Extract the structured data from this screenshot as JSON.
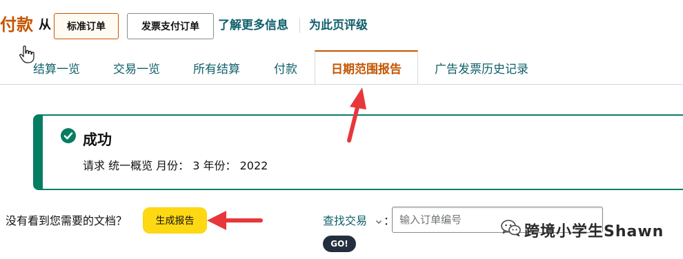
{
  "header": {
    "title": "付款",
    "from_label": "从",
    "standard_order_button": "标准订单",
    "invoice_order_button": "发票支付订单",
    "learn_more_link": "了解更多信息",
    "rate_page_link": "为此页评级"
  },
  "tabs": [
    {
      "label": "结算一览",
      "active": false
    },
    {
      "label": "交易一览",
      "active": false
    },
    {
      "label": "所有结算",
      "active": false
    },
    {
      "label": "付款",
      "active": false
    },
    {
      "label": "日期范围报告",
      "active": true
    },
    {
      "label": "广告发票历史记录",
      "active": false
    }
  ],
  "alert": {
    "title": "成功",
    "body": "请求 统一概览 月份： 3 年份： 2022",
    "icon": "check-circle-icon"
  },
  "report": {
    "prompt": "没有看到您需要的文档？",
    "generate_button": "生成报告"
  },
  "search": {
    "label": "查找交易",
    "colon": "：",
    "placeholder": "输入订单编号",
    "go_button": "GO!"
  },
  "watermark": {
    "text": "跨境小学生Shawn",
    "icon": "wechat-icon"
  },
  "colors": {
    "accent_orange": "#c45500",
    "link_teal": "#0f5f6a",
    "success_green": "#067d62",
    "generate_yellow": "#ffd814",
    "annotation_red": "#e8373b"
  }
}
